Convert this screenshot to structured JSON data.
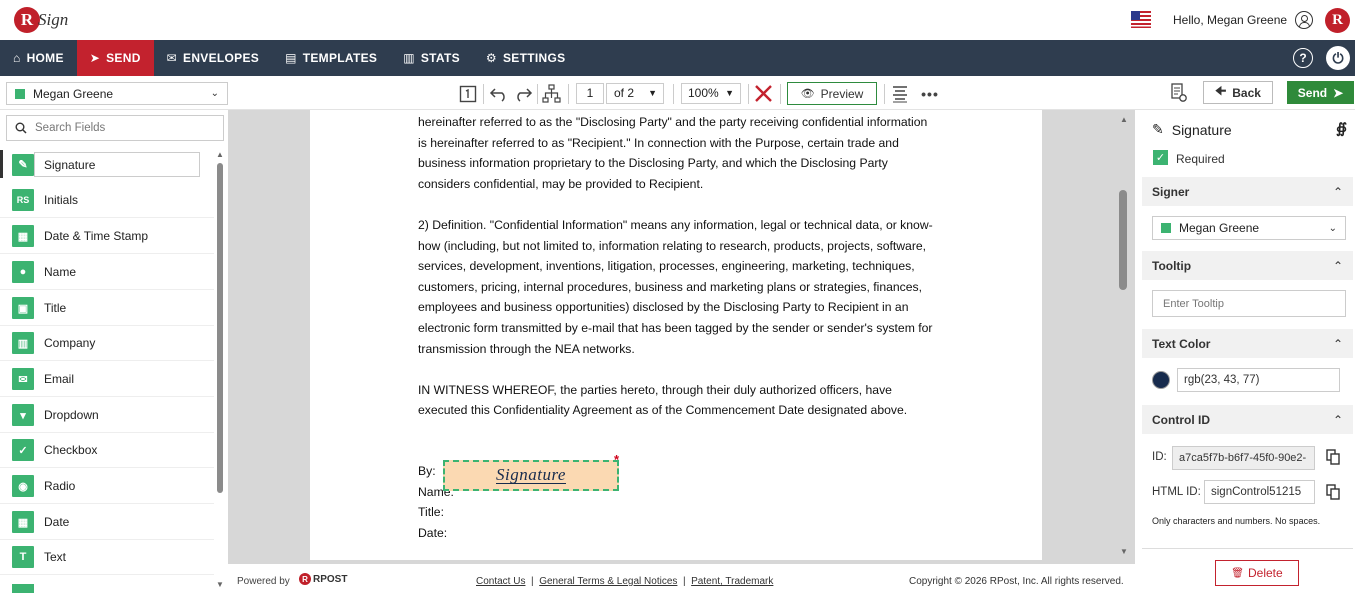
{
  "header": {
    "logo_r": "R",
    "logo_text": "Sign",
    "greeting": "Hello, Megan Greene",
    "brand_r": "R"
  },
  "nav": {
    "items": [
      {
        "label": "HOME",
        "icon": "home-icon",
        "glyph": "⌂"
      },
      {
        "label": "SEND",
        "icon": "send-icon",
        "glyph": "➤"
      },
      {
        "label": "ENVELOPES",
        "icon": "envelope-icon",
        "glyph": "✉"
      },
      {
        "label": "TEMPLATES",
        "icon": "template-icon",
        "glyph": "▤"
      },
      {
        "label": "STATS",
        "icon": "stats-icon",
        "glyph": "▥"
      },
      {
        "label": "SETTINGS",
        "icon": "gear-icon",
        "glyph": "⚙"
      }
    ],
    "active": "SEND",
    "help": "?",
    "power": "⏻"
  },
  "toolbar": {
    "recipient": "Megan Greene",
    "page_current": "1",
    "page_of": "of  2",
    "zoom": "100%",
    "preview": "Preview",
    "back": "Back",
    "send": "Send"
  },
  "left_panel": {
    "search_placeholder": "Search Fields",
    "fields": [
      {
        "label": "Signature",
        "glyph": "✎"
      },
      {
        "label": "Initials",
        "glyph": "RS"
      },
      {
        "label": "Date & Time Stamp",
        "glyph": "▦"
      },
      {
        "label": "Name",
        "glyph": "●"
      },
      {
        "label": "Title",
        "glyph": "▣"
      },
      {
        "label": "Company",
        "glyph": "▥"
      },
      {
        "label": "Email",
        "glyph": "✉"
      },
      {
        "label": "Dropdown",
        "glyph": "▾"
      },
      {
        "label": "Checkbox",
        "glyph": "✓"
      },
      {
        "label": "Radio",
        "glyph": "◉"
      },
      {
        "label": "Date",
        "glyph": "▦"
      },
      {
        "label": "Text",
        "glyph": "T"
      }
    ]
  },
  "document": {
    "paragraphs": [
      "hereinafter referred to as the \"Disclosing Party\" and the party receiving confidential information is hereinafter referred to as \"Recipient.\"  In connection with the Purpose, certain trade and business information proprietary to the Disclosing Party, and which the Disclosing Party considers confidential, may be provided to Recipient.",
      "2) Definition.  \"Confidential Information\" means any information, legal or technical data, or know-how (including, but not limited to, information relating to research, products, projects, software, services, development, inventions, litigation, processes, engineering, marketing, techniques, customers, pricing, internal procedures, business and marketing plans or strategies, finances, employees and business opportunities) disclosed by the Disclosing Party to Recipient in an electronic form transmitted by e-mail that has been tagged by the sender or sender's system for transmission through the NEA networks.",
      "IN WITNESS WHEREOF, the parties hereto, through their duly authorized officers, have executed this Confidentiality Agreement as of the Commencement Date designated above."
    ],
    "by_label": "By:",
    "name_label": "Name:",
    "title_label": "Title:",
    "date_label": "Date:",
    "signature_field": "Signature",
    "required_mark": "*"
  },
  "footer": {
    "powered_by": "Powered by",
    "rpost": "RPOST",
    "links": [
      "Contact Us",
      "General Terms & Legal Notices",
      "Patent, Trademark"
    ],
    "copyright": "Copyright © 2026 RPost, Inc. All rights reserved."
  },
  "right_panel": {
    "title": "Signature",
    "required_label": "Required",
    "required_checked": true,
    "signer_heading": "Signer",
    "signer_value": "Megan Greene",
    "tooltip_heading": "Tooltip",
    "tooltip_placeholder": "Enter Tooltip",
    "text_color_heading": "Text Color",
    "text_color_value": "rgb(23, 43, 77)",
    "control_id_heading": "Control ID",
    "id_label": "ID:",
    "id_value": "a7ca5f7b-b6f7-45f0-90e2-",
    "html_id_label": "HTML ID:",
    "html_id_value": "signControl51215",
    "hint": "Only characters and numbers. No spaces.",
    "delete": "Delete"
  },
  "colors": {
    "nav_bg": "#2f3d4f",
    "accent_red": "#c3222e",
    "accent_green": "#3cb371",
    "send_green": "#2f8a3a",
    "signature_fill": "#fbd9b2",
    "text_color": "#172b4d"
  }
}
